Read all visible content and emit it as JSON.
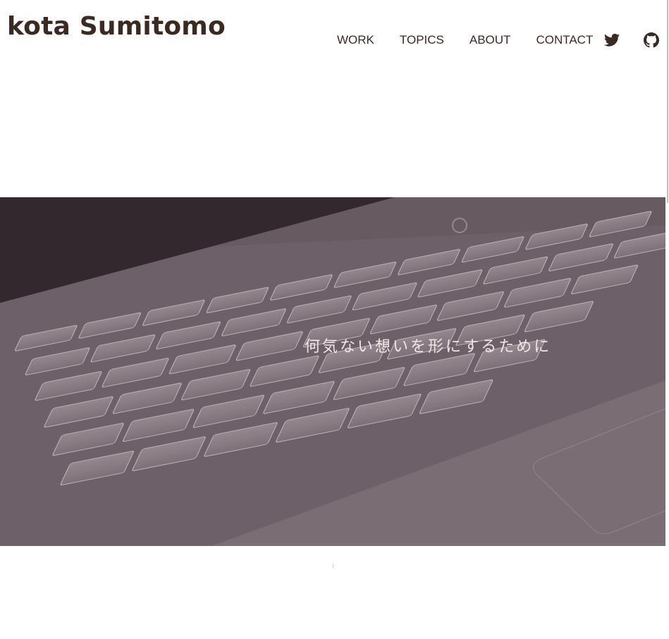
{
  "site": {
    "title": "kota Sumitomo"
  },
  "nav": {
    "items": [
      {
        "label": "WORK"
      },
      {
        "label": "TOPICS"
      },
      {
        "label": "ABOUT"
      },
      {
        "label": "CONTACT"
      }
    ]
  },
  "social": {
    "twitter_icon": "twitter-icon",
    "github_icon": "github-icon"
  },
  "hero": {
    "tagline": "何気ない想いを形にするために"
  },
  "colors": {
    "text": "#3b2a22",
    "hero_tone": "#7b6f77",
    "tagline": "#f1e6e6",
    "background": "#ffffff"
  }
}
